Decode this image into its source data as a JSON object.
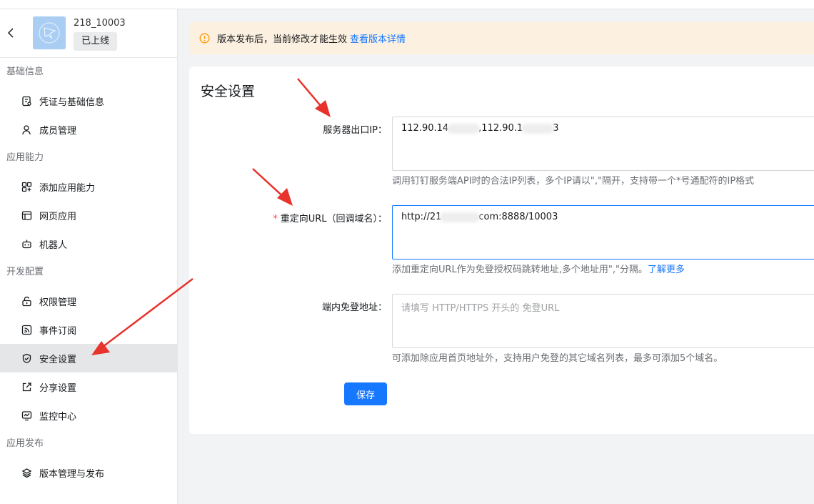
{
  "app": {
    "name": "218_10003",
    "status": "已上线"
  },
  "sidebar": {
    "groups": [
      {
        "title": "基础信息",
        "items": [
          "凭证与基础信息",
          "成员管理"
        ]
      },
      {
        "title": "应用能力",
        "items": [
          "添加应用能力",
          "网页应用",
          "机器人"
        ]
      },
      {
        "title": "开发配置",
        "items": [
          "权限管理",
          "事件订阅",
          "安全设置",
          "分享设置",
          "监控中心"
        ]
      },
      {
        "title": "应用发布",
        "items": [
          "版本管理与发布"
        ]
      }
    ],
    "active_item": "安全设置"
  },
  "notice": {
    "text": "版本发布后，当前修改才能生效",
    "link": "查看版本详情"
  },
  "page": {
    "title": "安全设置",
    "ip": {
      "label": "服务器出口IP：",
      "value_part1": "112.90.14",
      "value_part2": ",112.90.1",
      "value_part3": "3",
      "help": "调用钉钉服务端API时的合法IP列表，多个IP请以\",\"隔开，支持带一个*号通配符的IP格式"
    },
    "redirect": {
      "required_mark": "*",
      "label": "重定向URL（回调域名）：",
      "value_part1": "http://21",
      "value_part2": "com:8888/10003",
      "help": "添加重定向URL作为免登授权码跳转地址,多个地址用\",\"分隔。",
      "help_link": "了解更多"
    },
    "sso": {
      "label": "端内免登地址：",
      "placeholder": "请填写 HTTP/HTTPS 开头的 免登URL",
      "help": "可添加除应用首页地址外，支持用户免登的其它域名列表，最多可添加5个域名。"
    },
    "save_label": "保存"
  },
  "colors": {
    "primary": "#1677ff",
    "warning": "#ff9200",
    "notice_bg": "#fcf0e0",
    "annotation_arrow": "#e8322c"
  }
}
